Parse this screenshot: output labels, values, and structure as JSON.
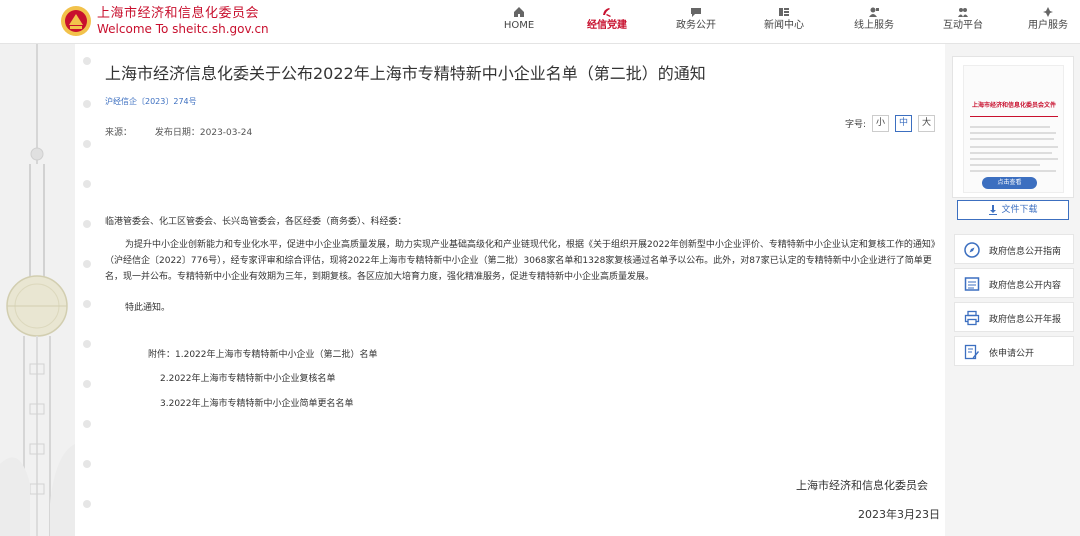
{
  "header": {
    "brand_cn": "上海市经济和信息化委员会",
    "brand_en": "Welcome To sheitc.sh.gov.cn",
    "nav": [
      {
        "label": "HOME",
        "icon": "home-icon"
      },
      {
        "label": "经信党建",
        "icon": "party-emblem-icon",
        "active": true
      },
      {
        "label": "政务公开",
        "icon": "chat-icon"
      },
      {
        "label": "新闻中心",
        "icon": "news-icon"
      },
      {
        "label": "线上服务",
        "icon": "user-service-icon"
      },
      {
        "label": "互动平台",
        "icon": "interaction-icon"
      },
      {
        "label": "用户服务",
        "icon": "user-icon"
      }
    ]
  },
  "article": {
    "title": "上海市经济信息化委关于公布2022年上海市专精特新中小企业名单（第二批）的通知",
    "doc_no": "沪经信企〔2023〕274号",
    "source_label": "来源：",
    "publish_date": "发布日期：2023-03-24",
    "font_size_label": "字号:",
    "font_sizes": [
      "小",
      "中",
      "大"
    ],
    "addressee": "临港管委会、化工区管委会、长兴岛管委会，各区经委（商务委）、科经委：",
    "body": "为提升中小企业创新能力和专业化水平，促进中小企业高质量发展，助力实现产业基础高级化和产业链现代化，根据《关于组织开展2022年创新型中小企业评价、专精特新中小企业认定和复核工作的通知》（沪经信企〔2022〕776号），经专家评审和综合评估，现将2022年上海市专精特新中小企业（第二批）3068家名单和1328家复核通过名单予以公布。此外，对87家已认定的专精特新中小企业进行了简单更名，现一并公布。专精特新中小企业有效期为三年，到期复核。各区应加大培育力度，强化精准服务，促进专精特新中小企业高质量发展。",
    "notice": "特此通知。",
    "attachments": [
      "附件：1.2022年上海市专精特新中小企业（第二批）名单",
      "2.2022年上海市专精特新中小企业复核名单",
      "3.2022年上海市专精特新中小企业简单更名名单"
    ],
    "signature": "上海市经济和信息化委员会",
    "sign_date": "2023年3月23日"
  },
  "sidebar": {
    "doc_preview_title": "上海市经济和信息化委员会文件",
    "doc_preview_button": "点击查看",
    "download_label": "文件下载",
    "links": [
      {
        "label": "政府信息公开指南",
        "icon": "compass-icon"
      },
      {
        "label": "政府信息公开内容",
        "icon": "list-doc-icon"
      },
      {
        "label": "政府信息公开年报",
        "icon": "printer-icon"
      },
      {
        "label": "依申请公开",
        "icon": "edit-doc-icon"
      }
    ]
  },
  "colors": {
    "brand_red": "#c8102e",
    "link_blue": "#3c6fc0"
  }
}
